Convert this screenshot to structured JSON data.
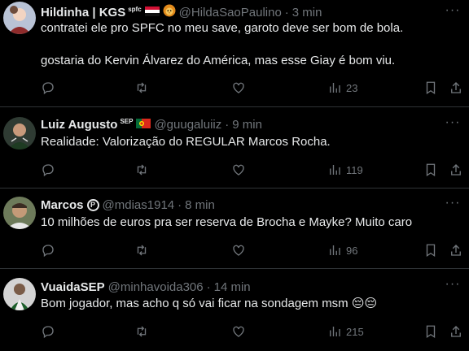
{
  "tweets": [
    {
      "name": "Hildinha | KGS",
      "tag": "spfc",
      "handle": "@HildaSaoPaulino",
      "time": "3 min",
      "lines": [
        "contratei ele pro SPFC no meu save, garoto deve ser bom de bola.",
        "gostaria do Kervin Álvarez do América, mas esse Giay é bom viu."
      ],
      "views": "23",
      "avatar_color": "#9aa7c0"
    },
    {
      "name": "Luiz Augusto",
      "tag": "SEP",
      "handle": "@guugaluiiz",
      "time": "9 min",
      "lines": [
        "Realidade: Valorização do REGULAR Marcos Rocha."
      ],
      "views": "119",
      "avatar_color": "#3b4a3a"
    },
    {
      "name": "Marcos",
      "tag": "P",
      "handle": "@mdias1914",
      "time": "8 min",
      "lines": [
        "10 milhões de euros pra ser reserva de Brocha e Mayke? Muito caro"
      ],
      "views": "96",
      "avatar_color": "#8a7a5c"
    },
    {
      "name": "VuaidaSEP",
      "tag": "",
      "handle": "@minhavoida306",
      "time": "14 min",
      "lines": [
        "Bom jogador, mas acho q só vai ficar na sondagem msm 😔😔"
      ],
      "views": "215",
      "avatar_color": "#c9c9c9"
    }
  ],
  "separator": "·",
  "more_label": "···",
  "colors": {
    "background": "#000000",
    "text": "#e7e9ea",
    "muted": "#71767b",
    "border": "#2f3336"
  },
  "icons": {
    "reply": "reply-icon",
    "retweet": "retweet-icon",
    "like": "heart-icon",
    "views": "views-icon",
    "bookmark": "bookmark-icon",
    "share": "share-icon"
  }
}
